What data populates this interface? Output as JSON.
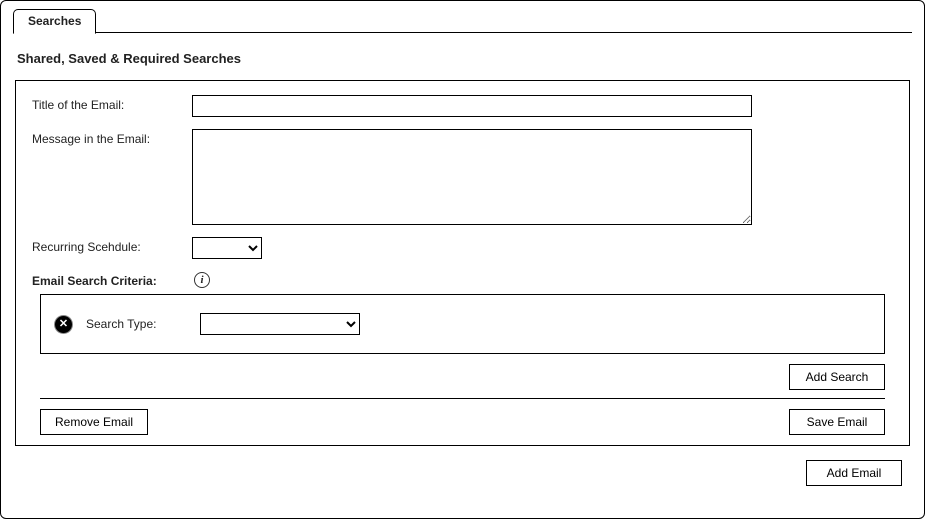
{
  "tab": {
    "label": "Searches"
  },
  "section_title": "Shared, Saved & Required Searches",
  "form": {
    "title_label": "Title of the Email:",
    "title_value": "",
    "message_label": "Message in the Email:",
    "message_value": "",
    "schedule_label": "Recurring Scehdule:",
    "schedule_value": "",
    "criteria_heading": "Email Search Criteria:",
    "info_glyph": "i"
  },
  "criteria": {
    "remove_glyph": "✕",
    "search_type_label": "Search Type:",
    "search_type_value": ""
  },
  "buttons": {
    "add_search": "Add Search",
    "remove_email": "Remove Email",
    "save_email": "Save Email",
    "add_email": "Add Email"
  }
}
